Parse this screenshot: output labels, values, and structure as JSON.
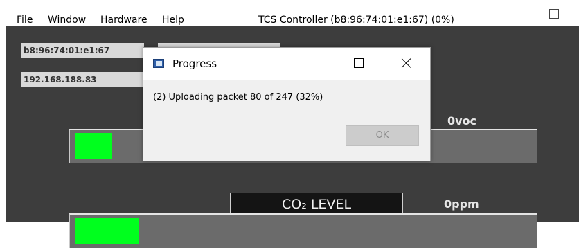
{
  "menu": {
    "items": [
      "File",
      "Window",
      "Hardware",
      "Help"
    ]
  },
  "window": {
    "title": "TCS Controller (b8:96:74:01:e1:67) (0%)"
  },
  "info": {
    "mac_address": "b8:96:74:01:e1:67",
    "ip_address": "192.168.188.83"
  },
  "gauges": {
    "voc": {
      "value_text": "0voc",
      "level_fraction": 0.08
    },
    "co2": {
      "label": "CO₂ LEVEL",
      "value_text": "0ppm",
      "level_fraction": 0.14
    }
  },
  "dialog": {
    "title": "Progress",
    "message": "(2) Uploading packet 80 of 247 (32%)",
    "ok_label": "OK",
    "progress_percent": 32
  },
  "colors": {
    "panel": "#3d3d3d",
    "gauge_fill": "#00ff1e",
    "gauge_track": "#6b6b6b",
    "field": "#d9d9d9"
  },
  "icons": {
    "window_minimize": "minimize-icon",
    "window_maximize": "maximize-icon",
    "dialog_app": "app-window-icon",
    "dialog_close": "close-icon"
  }
}
